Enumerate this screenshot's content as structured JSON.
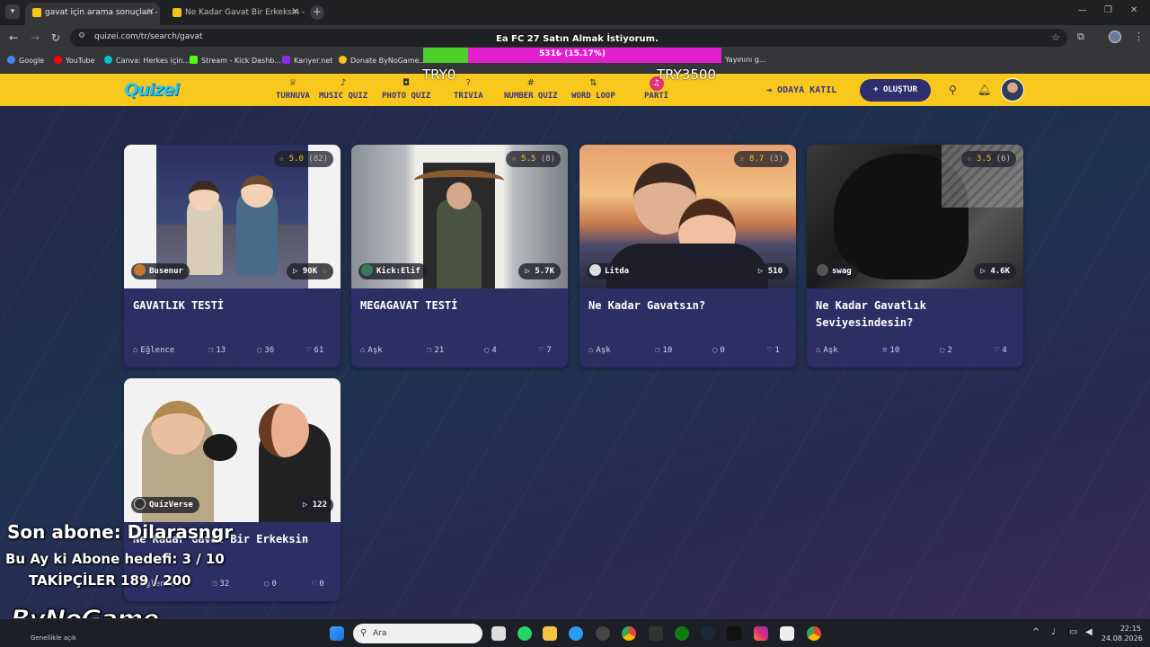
{
  "browser": {
    "tabs": [
      {
        "title": "gavat için arama sonuçları - Qu",
        "active": true
      },
      {
        "title": "Ne Kadar Gavat Bir Erkeksin - T",
        "active": false
      }
    ],
    "url": "quizei.com/tr/search/gavat",
    "bookmarks": [
      {
        "label": "Google",
        "color": "#4285f4"
      },
      {
        "label": "YouTube",
        "color": "#ff0000"
      },
      {
        "label": "Canva: Herkes için...",
        "color": "#00c4cc"
      },
      {
        "label": "Stream - Kick Dashb...",
        "color": "#53fc18"
      },
      {
        "label": "Kariyer.net",
        "color": "#8a2be2"
      },
      {
        "label": "Donate ByNoGame...",
        "color": "#f5c518"
      },
      {
        "label": "Yayınını g...",
        "color": "#888888"
      }
    ]
  },
  "overlay": {
    "goal_title": "Ea FC 27 Satın Almak İstiyorum.",
    "goal_progress_text": "531₺ (15.17%)",
    "goal_fraction": 0.1517,
    "goal_min": "TRY0",
    "goal_max": "TRY3500",
    "last_sub": "Son abone: Dilarasngr",
    "monthly_goal": "Bu Ay ki Abone hedefi: 3 / 10",
    "followers": "TAKİPÇİLER 189 / 200",
    "brand": "ByNoGame"
  },
  "site": {
    "logo": "Quizei",
    "nav": [
      {
        "label": "TURNUVA",
        "icon": "trophy-icon"
      },
      {
        "label": "MUSIC QUIZ",
        "icon": "music-icon"
      },
      {
        "label": "PHOTO QUIZ",
        "icon": "camera-icon"
      },
      {
        "label": "TRIVIA",
        "icon": "question-icon"
      },
      {
        "label": "NUMBER QUIZ",
        "icon": "hash-icon"
      },
      {
        "label": "WORD LOOP",
        "icon": "word-icon"
      },
      {
        "label": "PARTİ",
        "icon": "party-icon"
      }
    ],
    "join_label": "ODAYA KATIL",
    "create_label": "+ OLUŞTUR"
  },
  "cards": [
    {
      "title": "GAVATLIK TESTİ",
      "rating": "5.0",
      "rating_count": "(82)",
      "author": "Busenur",
      "plays": "90K",
      "hot": true,
      "category": "Eğlence",
      "questions": "13",
      "comments": "36",
      "likes": "61",
      "count_icon": "stack"
    },
    {
      "title": "MEGAGAVAT TESTİ",
      "rating": "5.5",
      "rating_count": "(8)",
      "author": "Kick:Elif",
      "plays": "5.7K",
      "hot": false,
      "category": "Aşk",
      "questions": "21",
      "comments": "4",
      "likes": "7",
      "count_icon": "stack"
    },
    {
      "title": "Ne Kadar Gavatsın?",
      "rating": "8.7",
      "rating_count": "(3)",
      "author": "Litda",
      "plays": "510",
      "hot": false,
      "category": "Aşk",
      "questions": "10",
      "comments": "0",
      "likes": "1",
      "count_icon": "stack"
    },
    {
      "title": "Ne Kadar Gavatlık Seviyesindesin?",
      "rating": "3.5",
      "rating_count": "(6)",
      "author": "swag",
      "plays": "4.6K",
      "hot": false,
      "category": "Aşk",
      "questions": "10",
      "comments": "2",
      "likes": "4",
      "count_icon": "list"
    },
    {
      "title": "Ne Kadar Gavat Bir Erkeksin",
      "rating": "",
      "rating_count": "",
      "author": "QuizVerse",
      "plays": "122",
      "hot": false,
      "category": "Eğlence",
      "questions": "32",
      "comments": "0",
      "likes": "0",
      "count_icon": "stack"
    }
  ],
  "taskbar": {
    "search_placeholder": "Ara",
    "weather": "Genellikle açık",
    "time": "22:15",
    "date": "24.08.2026"
  }
}
